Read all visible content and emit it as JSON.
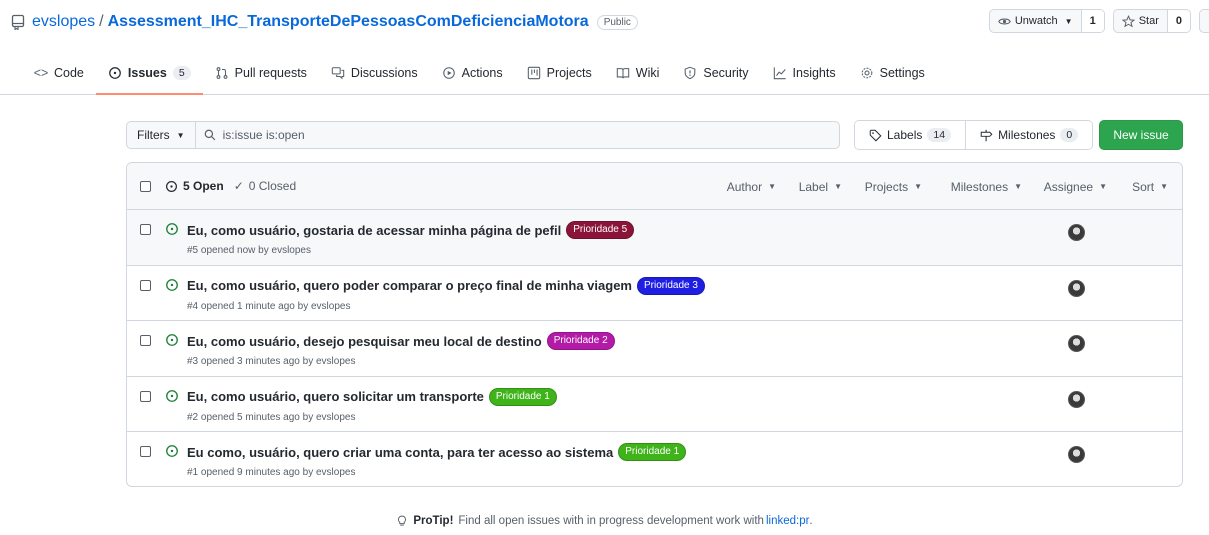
{
  "repo": {
    "owner": "evslopes",
    "separator": "/",
    "name": "Assessment_IHC_TransporteDePessoasComDeficienciaMotora",
    "visibility": "Public"
  },
  "actions": {
    "unwatch_label": "Unwatch",
    "unwatch_count": "1",
    "star_label": "Star",
    "star_count": "0"
  },
  "tabs": [
    {
      "label": "Code",
      "icon": "code-icon"
    },
    {
      "label": "Issues",
      "icon": "issue-icon",
      "count": "5"
    },
    {
      "label": "Pull requests",
      "icon": "pull-request-icon"
    },
    {
      "label": "Discussions",
      "icon": "discussion-icon"
    },
    {
      "label": "Actions",
      "icon": "play-icon"
    },
    {
      "label": "Projects",
      "icon": "project-icon"
    },
    {
      "label": "Wiki",
      "icon": "book-icon"
    },
    {
      "label": "Security",
      "icon": "shield-icon"
    },
    {
      "label": "Insights",
      "icon": "graph-icon"
    },
    {
      "label": "Settings",
      "icon": "gear-icon"
    }
  ],
  "filters": {
    "button_label": "Filters",
    "search_value": "is:issue is:open",
    "labels_label": "Labels",
    "labels_count": "14",
    "milestones_label": "Milestones",
    "milestones_count": "0",
    "new_issue_label": "New issue"
  },
  "list_header": {
    "open_label": "5 Open",
    "closed_label": "0 Closed",
    "filters": [
      "Author",
      "Label",
      "Projects",
      "Milestones",
      "Assignee",
      "Sort"
    ]
  },
  "issues": [
    {
      "title": "Eu, como usuário, gostaria de acessar minha página de pefil",
      "label": "Prioridade 5",
      "label_color": "#8b1538",
      "meta": "#5 opened now by evslopes"
    },
    {
      "title": "Eu, como usuário, quero poder comparar o preço final de minha viagem",
      "label": "Prioridade 3",
      "label_color": "#1f1ee3",
      "meta": "#4 opened 1 minute ago by evslopes"
    },
    {
      "title": "Eu, como usuário, desejo pesquisar meu local de destino",
      "label": "Prioridade 2",
      "label_color": "#b31aa8",
      "meta": "#3 opened 3 minutes ago by evslopes"
    },
    {
      "title": "Eu, como usuário, quero solicitar um transporte",
      "label": "Prioridade 1",
      "label_color": "#3fb31a",
      "meta": "#2 opened 5 minutes ago by evslopes"
    },
    {
      "title": "Eu como, usuário, quero criar uma conta, para ter acesso ao sistema",
      "label": "Prioridade 1",
      "label_color": "#3fb31a",
      "meta": "#1 opened 9 minutes ago by evslopes"
    }
  ],
  "protip": {
    "bold": "ProTip!",
    "text": "Find all open issues with in progress development work with",
    "link": "linked:pr",
    "end": "."
  }
}
